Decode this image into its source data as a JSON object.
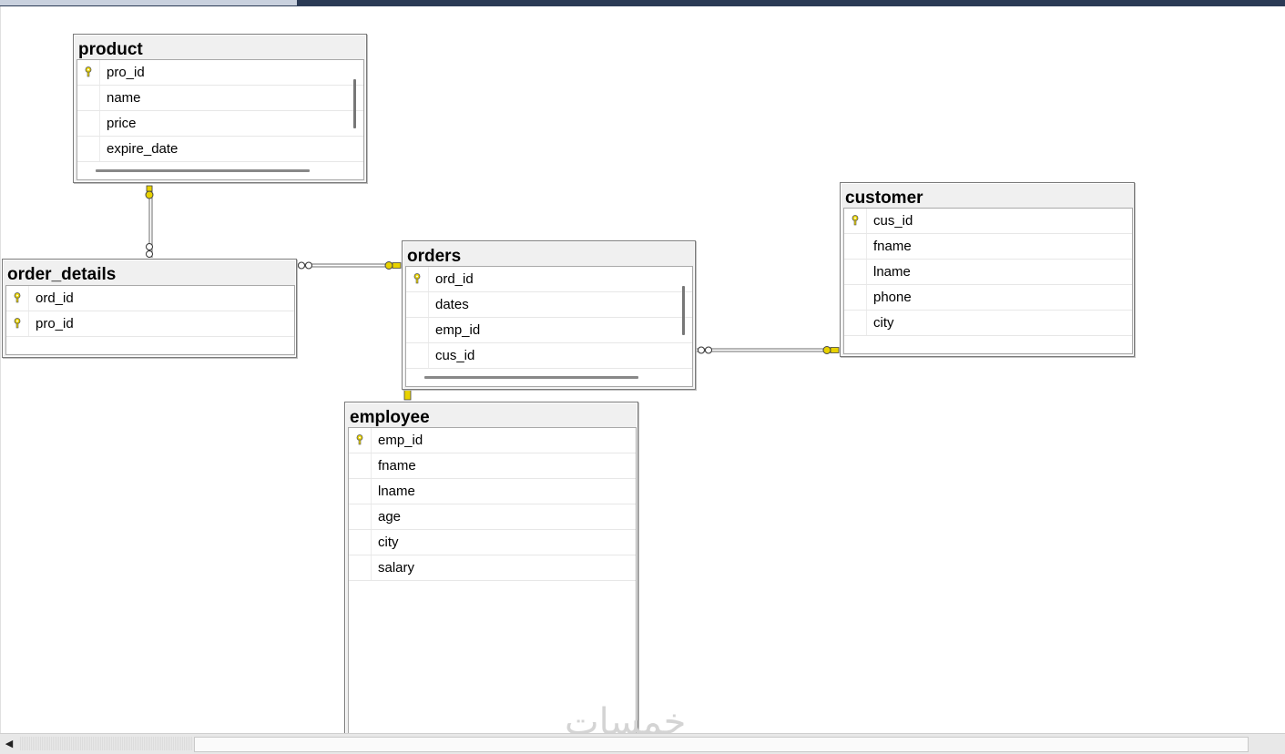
{
  "diagram": {
    "tables": [
      {
        "id": "product",
        "title": "product",
        "columns": [
          {
            "name": "pro_id",
            "pk": true
          },
          {
            "name": "name",
            "pk": false
          },
          {
            "name": "price",
            "pk": false
          },
          {
            "name": "expire_date",
            "pk": false
          }
        ]
      },
      {
        "id": "order_details",
        "title": "order_details",
        "columns": [
          {
            "name": "ord_id",
            "pk": true
          },
          {
            "name": "pro_id",
            "pk": true
          }
        ]
      },
      {
        "id": "orders",
        "title": "orders",
        "columns": [
          {
            "name": "ord_id",
            "pk": true
          },
          {
            "name": "dates",
            "pk": false
          },
          {
            "name": "emp_id",
            "pk": false
          },
          {
            "name": "cus_id",
            "pk": false
          }
        ]
      },
      {
        "id": "customer",
        "title": "customer",
        "columns": [
          {
            "name": "cus_id",
            "pk": true
          },
          {
            "name": "fname",
            "pk": false
          },
          {
            "name": "lname",
            "pk": false
          },
          {
            "name": "phone",
            "pk": false
          },
          {
            "name": "city",
            "pk": false
          }
        ]
      },
      {
        "id": "employee",
        "title": "employee",
        "columns": [
          {
            "name": "emp_id",
            "pk": true
          },
          {
            "name": "fname",
            "pk": false
          },
          {
            "name": "lname",
            "pk": false
          },
          {
            "name": "age",
            "pk": false
          },
          {
            "name": "city",
            "pk": false
          },
          {
            "name": "salary",
            "pk": false
          }
        ]
      }
    ],
    "relationships": [
      {
        "from": "product",
        "to": "order_details",
        "one_end": "product",
        "many_end": "order_details"
      },
      {
        "from": "orders",
        "to": "order_details",
        "one_end": "orders",
        "many_end": "order_details"
      },
      {
        "from": "customer",
        "to": "orders",
        "one_end": "customer",
        "many_end": "orders"
      },
      {
        "from": "employee",
        "to": "orders",
        "one_end": "orders",
        "many_end": "employee"
      }
    ]
  },
  "watermark": "خمسات",
  "colors": {
    "key": "#e8d200",
    "line": "#6e6e6e",
    "title_bg": "#f0f0f0"
  }
}
